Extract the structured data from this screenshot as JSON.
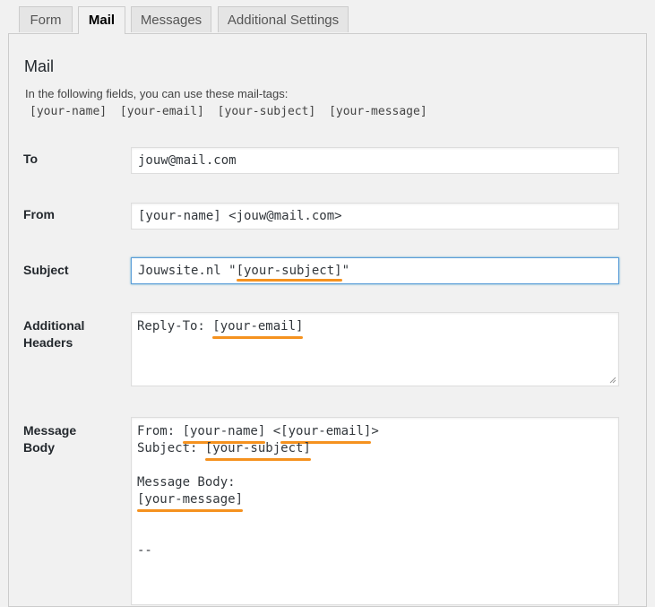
{
  "tabs": [
    {
      "label": "Form",
      "active": false
    },
    {
      "label": "Mail",
      "active": true
    },
    {
      "label": "Messages",
      "active": false
    },
    {
      "label": "Additional Settings",
      "active": false
    }
  ],
  "mail": {
    "title": "Mail",
    "intro": "In the following fields, you can use these mail-tags:",
    "tags": [
      "[your-name]",
      "[your-email]",
      "[your-subject]",
      "[your-message]"
    ]
  },
  "fields": {
    "to": {
      "label": "To",
      "value": "jouw@mail.com"
    },
    "from": {
      "label": "From",
      "value": "[your-name] <jouw@mail.com>"
    },
    "subject": {
      "label": "Subject",
      "prefix": "Jouwsite.nl \"",
      "tag": "[your-subject]",
      "suffix": "\""
    },
    "headers": {
      "label1": "Additional",
      "label2": "Headers",
      "prefix": "Reply-To: ",
      "tag": "[your-email]"
    },
    "body": {
      "label1": "Message",
      "label2": "Body",
      "line1_prefix": "From: ",
      "line1_tag1": "[your-name]",
      "line1_mid": " <",
      "line1_tag2": "[your-email]",
      "line1_suffix": ">",
      "line2_prefix": "Subject: ",
      "line2_tag": "[your-subject]",
      "line4": "Message Body:",
      "line5_tag": "[your-message]",
      "line8": "--"
    }
  },
  "colors": {
    "highlight": "#f5921f",
    "focus": "#5b9dd9"
  }
}
